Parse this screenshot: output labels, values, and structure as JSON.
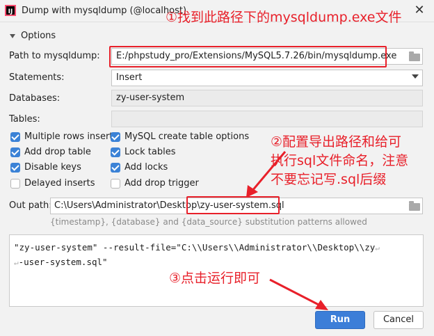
{
  "window": {
    "title": "Dump with mysqldump (@localhost)",
    "close_glyph": "✕",
    "app_icon_text": "IJ"
  },
  "options": {
    "header": "Options",
    "path_label": "Path to mysqldump:",
    "path_value": "E:/phpstudy_pro/Extensions/MySQL5.7.26/bin/mysqldump.exe",
    "statements_label": "Statements:",
    "statements_value": "Insert",
    "databases_label": "Databases:",
    "databases_value": "zy-user-system",
    "tables_label": "Tables:",
    "tables_value": ""
  },
  "checkboxes": [
    {
      "label": "Multiple rows inserts",
      "checked": true
    },
    {
      "label": "MySQL create table options",
      "checked": true
    },
    {
      "label": "Add drop table",
      "checked": true
    },
    {
      "label": "Lock tables",
      "checked": true
    },
    {
      "label": "Disable keys",
      "checked": true
    },
    {
      "label": "Add locks",
      "checked": true
    },
    {
      "label": "Delayed inserts",
      "checked": false
    },
    {
      "label": "Add drop trigger",
      "checked": false
    }
  ],
  "out_path": {
    "label": "Out path:",
    "dir": "C:\\Users\\Administrator\\Desktop\\",
    "file": "zy-user-system.sql",
    "hint": "{timestamp}, {database} and {data_source} substitution patterns allowed"
  },
  "command": {
    "line1": "\"zy-user-system\" --result-file=\"C:\\\\Users\\\\Administrator\\\\Desktop\\\\zy",
    "line2": "-user-system.sql\"",
    "wrap_glyph": "↵"
  },
  "buttons": {
    "run": "Run",
    "cancel": "Cancel"
  },
  "annotations": {
    "step1": "①找到此路径下的mysqldump.exe文件",
    "step2_line1": "②配置导出路径和给可",
    "step2_line2": "执行sql文件命名，注意",
    "step2_line3": "不要忘记写.sql后缀",
    "step3": "③点击运行即可"
  },
  "colors": {
    "accent": "#3c7ed8",
    "annotation_red": "#e8202a"
  },
  "icons": {
    "folder": "folder-icon",
    "dropdown": "chevron-down-icon",
    "close": "close-icon"
  }
}
